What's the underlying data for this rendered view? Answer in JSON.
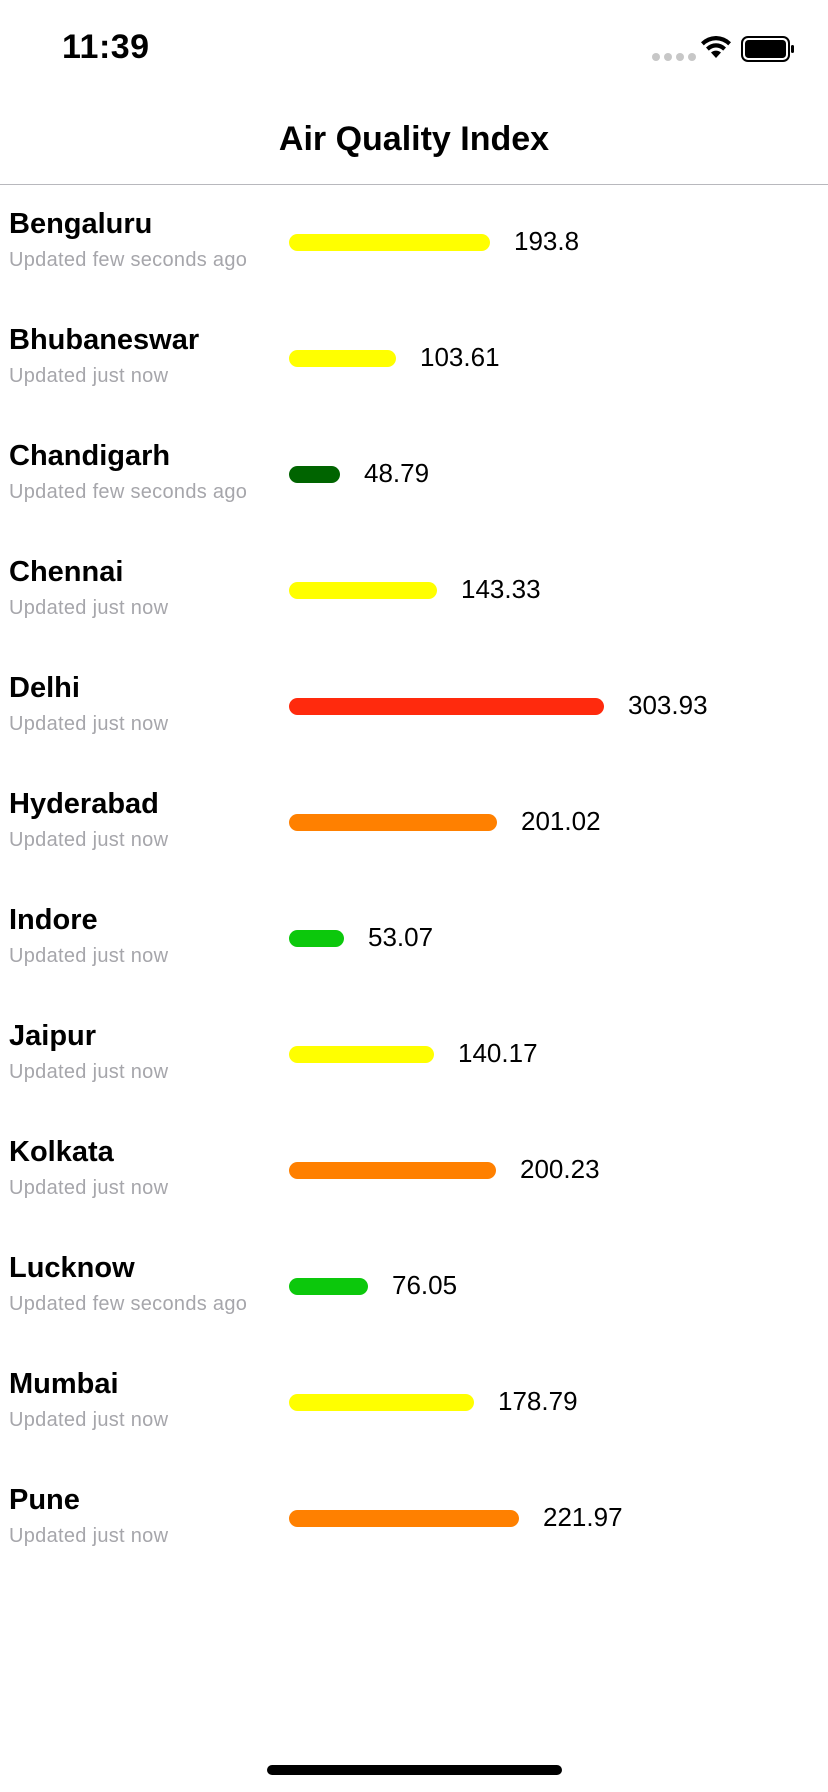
{
  "status_bar": {
    "time": "11:39"
  },
  "header": {
    "title": "Air Quality Index"
  },
  "cities": [
    {
      "name": "Bengaluru",
      "updated": "Updated few seconds ago",
      "aqi": "193.8",
      "aqi_value": 193.8,
      "color": "#ffff00"
    },
    {
      "name": "Bhubaneswar",
      "updated": "Updated just now",
      "aqi": "103.61",
      "aqi_value": 103.61,
      "color": "#ffff00"
    },
    {
      "name": "Chandigarh",
      "updated": "Updated few seconds ago",
      "aqi": "48.79",
      "aqi_value": 48.79,
      "color": "#006400"
    },
    {
      "name": "Chennai",
      "updated": "Updated just now",
      "aqi": "143.33",
      "aqi_value": 143.33,
      "color": "#ffff00"
    },
    {
      "name": "Delhi",
      "updated": "Updated just now",
      "aqi": "303.93",
      "aqi_value": 303.93,
      "color": "#ff2a0d"
    },
    {
      "name": "Hyderabad",
      "updated": "Updated just now",
      "aqi": "201.02",
      "aqi_value": 201.02,
      "color": "#ff8000"
    },
    {
      "name": "Indore",
      "updated": "Updated just now",
      "aqi": "53.07",
      "aqi_value": 53.07,
      "color": "#0cc80c"
    },
    {
      "name": "Jaipur",
      "updated": "Updated just now",
      "aqi": "140.17",
      "aqi_value": 140.17,
      "color": "#ffff00"
    },
    {
      "name": "Kolkata",
      "updated": "Updated just now",
      "aqi": "200.23",
      "aqi_value": 200.23,
      "color": "#ff8000"
    },
    {
      "name": "Lucknow",
      "updated": "Updated few seconds ago",
      "aqi": "76.05",
      "aqi_value": 76.05,
      "color": "#0cc80c"
    },
    {
      "name": "Mumbai",
      "updated": "Updated just now",
      "aqi": "178.79",
      "aqi_value": 178.79,
      "color": "#ffff00"
    },
    {
      "name": "Pune",
      "updated": "Updated just now",
      "aqi": "221.97",
      "aqi_value": 221.97,
      "color": "#ff8000"
    }
  ]
}
